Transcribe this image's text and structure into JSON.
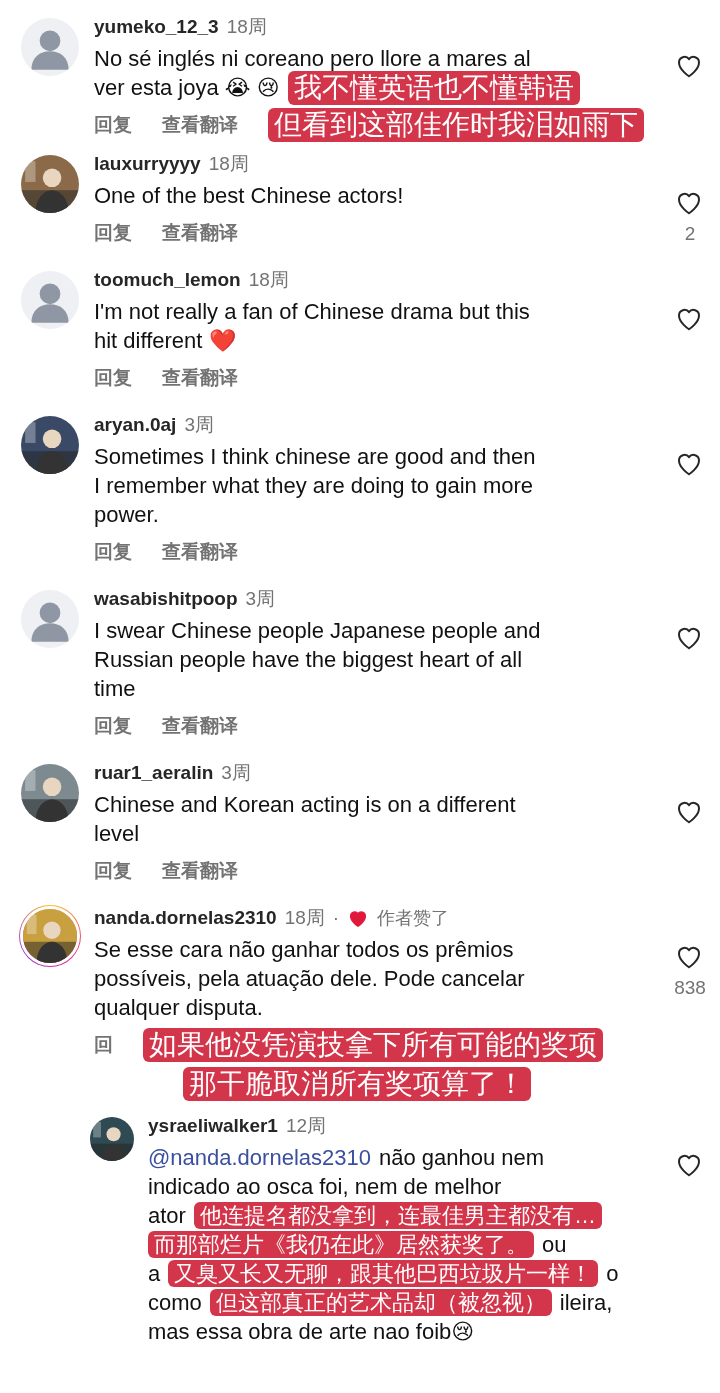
{
  "comments": [
    {
      "username": "yumeko_12_3",
      "time": "18周",
      "avatar": {
        "kind": "default"
      },
      "lines": [
        {
          "text": "No sé inglés ni coreano pero llore a mares al"
        },
        {
          "text": "ver esta joya 😭 😢",
          "caption": "我不懂英语也不懂韩语"
        }
      ],
      "actions": [
        "回复",
        "查看翻译"
      ],
      "action_captions": [
        "但看到这部佳作时我泪如雨下"
      ]
    },
    {
      "username": "lauxurryyyy",
      "time": "18周",
      "avatar": {
        "kind": "picture",
        "color": "#8a6a48"
      },
      "lines": [
        {
          "text": "One of the best Chinese actors!"
        }
      ],
      "actions": [
        "回复",
        "查看翻译"
      ],
      "like_count": "2"
    },
    {
      "username": "toomuch_lemon",
      "time": "18周",
      "avatar": {
        "kind": "default"
      },
      "lines": [
        {
          "text": "I'm not really a fan of Chinese drama but this"
        },
        {
          "text": "hit different ❤️"
        }
      ],
      "actions": [
        "回复",
        "查看翻译"
      ]
    },
    {
      "username": "aryan.0aj",
      "time": "3周",
      "avatar": {
        "kind": "picture",
        "color": "#3a4a66"
      },
      "lines": [
        {
          "text": "Sometimes I think chinese are good and then"
        },
        {
          "text": "I remember what they are doing to gain more"
        },
        {
          "text": "power."
        }
      ],
      "actions": [
        "回复",
        "查看翻译"
      ]
    },
    {
      "username": "wasabishitpoop",
      "time": "3周",
      "avatar": {
        "kind": "default"
      },
      "lines": [
        {
          "text": "I swear Chinese people Japanese people and"
        },
        {
          "text": "Russian people have the biggest heart of all"
        },
        {
          "text": "time"
        }
      ],
      "actions": [
        "回复",
        "查看翻译"
      ]
    },
    {
      "username": "ruar1_aeralin",
      "time": "3周",
      "avatar": {
        "kind": "picture",
        "color": "#7d8a90"
      },
      "lines": [
        {
          "text": "Chinese and Korean acting is on a different"
        },
        {
          "text": "level"
        }
      ],
      "actions": [
        "回复",
        "查看翻译"
      ]
    },
    {
      "username": "nanda.dornelas2310",
      "time": "18周",
      "story_ring": true,
      "author_liked": {
        "separator": "·",
        "label": "作者赞了"
      },
      "avatar": {
        "kind": "picture",
        "color": "#c9a040"
      },
      "lines": [
        {
          "text": "Se esse cara não ganhar todos os prêmios"
        },
        {
          "text": "possíveis, pela atuação dele. Pode cancelar"
        },
        {
          "text": "qualquer disputa."
        }
      ],
      "actions": [
        "回"
      ],
      "action_captions": [
        "如果他没凭演技拿下所有可能的奖项",
        "那干脆取消所有奖项算了！"
      ],
      "like_count": "838",
      "reply": {
        "username": "ysraeliwalker1",
        "time": "12周",
        "avatar": {
          "kind": "picture",
          "color": "#2f4a52"
        },
        "lines": [
          {
            "mention": "@nanda.dornelas2310",
            "text": " não ganhou nem"
          },
          {
            "text": "indicado ao osca foi, nem de melhor"
          },
          {
            "text": "ator",
            "caption": "他连提名都没拿到，连最佳男主都没有…"
          },
          {
            "caption": "而那部烂片《我仍在此》居然获奖了。",
            "right": "ou"
          },
          {
            "text": "a",
            "caption": "又臭又长又无聊，跟其他巴西垃圾片一样！",
            "right": "o"
          },
          {
            "text": "como",
            "caption": "但这部真正的艺术品却（被忽视）",
            "right": "ileira,"
          },
          {
            "text": "mas essa obra de arte nao foib😢"
          }
        ]
      }
    }
  ]
}
